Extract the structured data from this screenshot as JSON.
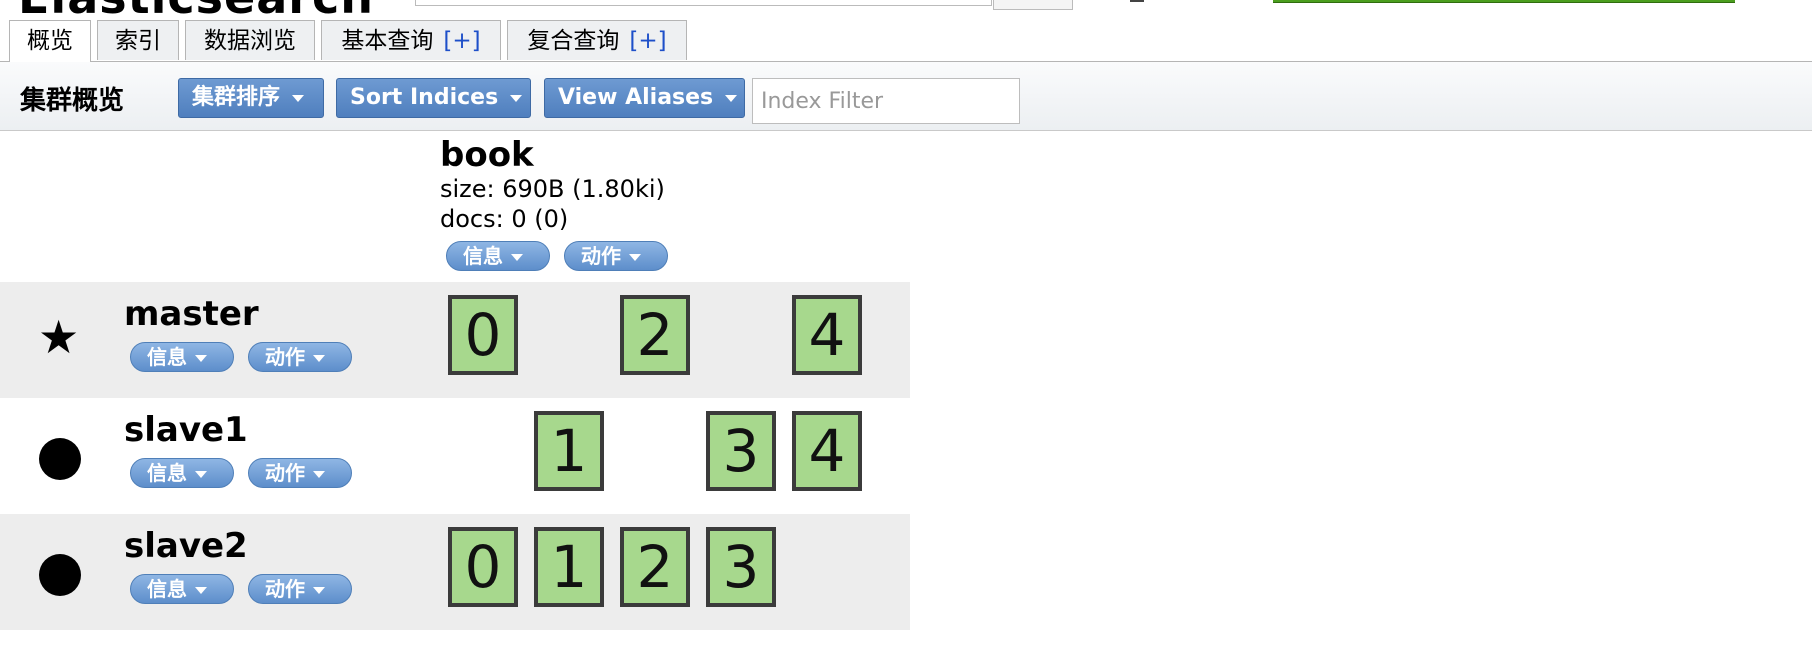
{
  "app": {
    "title": "Elasticsearch"
  },
  "tabs": [
    {
      "label": "概览",
      "plus": ""
    },
    {
      "label": "索引",
      "plus": ""
    },
    {
      "label": "数据浏览",
      "plus": ""
    },
    {
      "label": "基本查询",
      "plus": "[+]"
    },
    {
      "label": "复合查询",
      "plus": "[+]"
    }
  ],
  "toolbar": {
    "title": "集群概览",
    "sort_cluster_label": "集群排序",
    "sort_indices_label": "Sort Indices",
    "view_aliases_label": "View Aliases",
    "index_filter_placeholder": "Index Filter",
    "index_filter_value": ""
  },
  "index": {
    "name": "book",
    "size": "size: 690B (1.80ki)",
    "docs": "docs: 0 (0)",
    "info_label": "信息",
    "action_label": "动作"
  },
  "nodes": [
    {
      "name": "master",
      "icon": "star-icon",
      "info_label": "信息",
      "action_label": "动作",
      "shards": [
        "0",
        "2",
        "4"
      ]
    },
    {
      "name": "slave1",
      "icon": "dot-icon",
      "info_label": "信息",
      "action_label": "动作",
      "shards": [
        "1",
        "3",
        "4"
      ]
    },
    {
      "name": "slave2",
      "icon": "dot-icon",
      "info_label": "信息",
      "action_label": "动作",
      "shards": [
        "0",
        "1",
        "2",
        "3"
      ]
    }
  ],
  "colors": {
    "accent": "#5b88c4",
    "shard_fill": "#a7d88d",
    "health": "#4b9e1f",
    "tab_plus": "#1d4fc9"
  }
}
